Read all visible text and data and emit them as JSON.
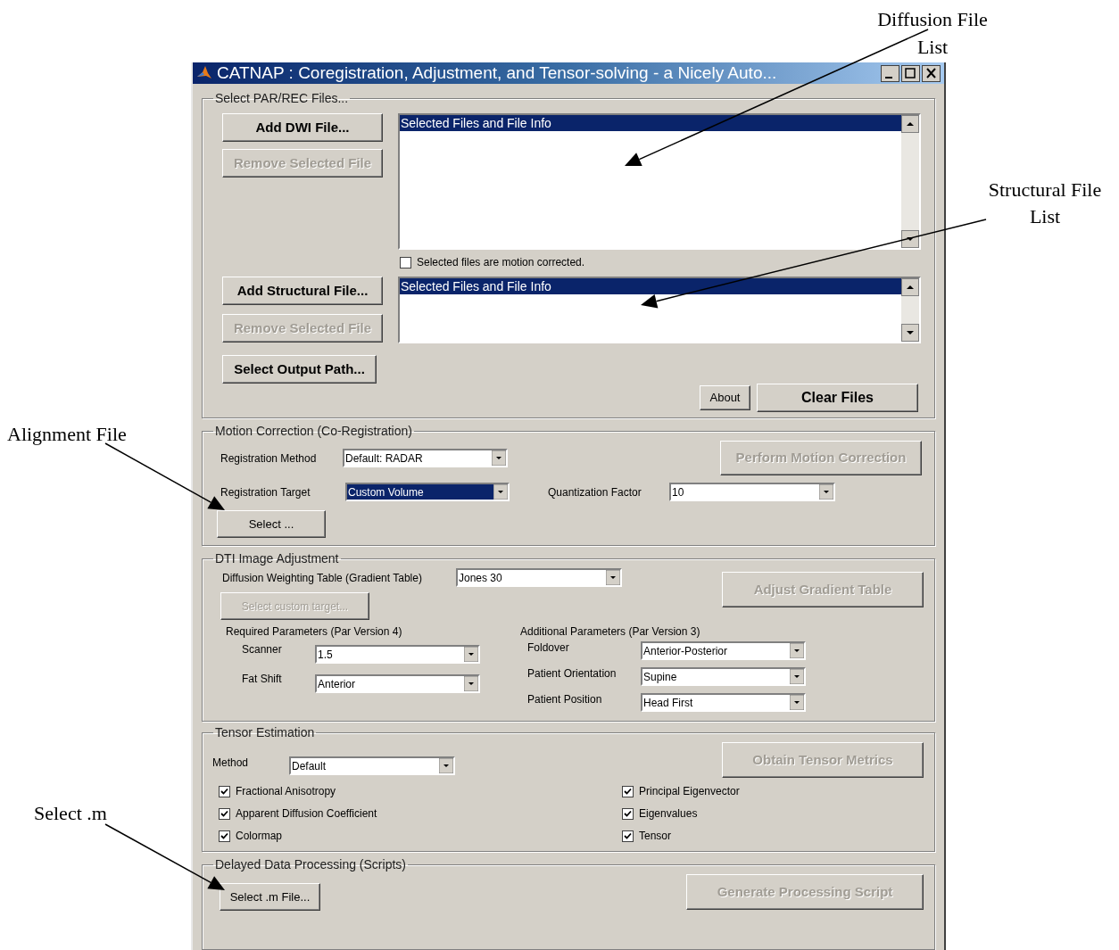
{
  "annotations": [
    {
      "text": "Diffusion File List"
    },
    {
      "text": "Structural File List"
    },
    {
      "text": "Alignment File"
    },
    {
      "text": "Select .m"
    }
  ],
  "window": {
    "title": "CATNAP : Coregistration, Adjustment, and Tensor-solving  - a Nicely Auto..."
  },
  "file_selection": {
    "title": "Select PAR/REC Files...",
    "dwi_buttons": [
      {
        "label": "Add DWI File...",
        "disabled": false
      },
      {
        "label": "Remove Selected File",
        "disabled": true
      }
    ],
    "dwi_list": {
      "header": "Selected Files and File Info"
    },
    "motion_corrected": {
      "label": "Selected files are motion corrected.",
      "checked": false
    },
    "structural_buttons": [
      {
        "label": "Add Structural File...",
        "disabled": false
      },
      {
        "label": "Remove Selected File",
        "disabled": true
      }
    ],
    "structural_list": {
      "header": "Selected Files and File Info"
    },
    "output_button": {
      "label": "Select Output Path..."
    },
    "about_button": {
      "label": "About"
    },
    "clear_button": {
      "label": "Clear Files"
    }
  },
  "motion_correction": {
    "title": "Motion Correction (Co-Registration)",
    "method": {
      "label": "Registration Method",
      "value": "Default: RADAR",
      "selected": false
    },
    "target": {
      "label": "Registration Target",
      "value": "Custom Volume",
      "selected": true
    },
    "quantization": {
      "label": "Quantization Factor",
      "value": "10",
      "selected": false
    },
    "select_button": {
      "label": "Select ..."
    },
    "perform_button": {
      "label": "Perform Motion Correction",
      "disabled": true
    }
  },
  "dti": {
    "title": "DTI Image Adjustment",
    "table": {
      "label": "Diffusion Weighting Table (Gradient Table)",
      "value": "Jones 30"
    },
    "custom_target_button": {
      "label": "Select custom target...",
      "disabled": true
    },
    "adjust_button": {
      "label": "Adjust Gradient Table",
      "disabled": true
    },
    "required": {
      "title": "Required Parameters (Par Version 4)",
      "fields": [
        {
          "label": "Scanner",
          "value": "1.5"
        },
        {
          "label": "Fat Shift",
          "value": "Anterior"
        }
      ]
    },
    "additional": {
      "title": "Additional Parameters (Par Version 3)",
      "fields": [
        {
          "label": "Foldover",
          "value": "Anterior-Posterior"
        },
        {
          "label": "Patient Orientation",
          "value": "Supine"
        },
        {
          "label": "Patient Position",
          "value": "Head First"
        }
      ]
    }
  },
  "tensor": {
    "title": "Tensor Estimation",
    "method": {
      "label": "Method",
      "value": "Default"
    },
    "obtain_button": {
      "label": "Obtain Tensor Metrics",
      "disabled": true
    },
    "checkboxes": [
      {
        "label": "Fractional Anisotropy",
        "checked": true
      },
      {
        "label": "Apparent Diffusion Coefficient",
        "checked": true
      },
      {
        "label": "Colormap",
        "checked": true
      },
      {
        "label": "Principal Eigenvector",
        "checked": true
      },
      {
        "label": "Eigenvalues",
        "checked": true
      },
      {
        "label": "Tensor",
        "checked": true
      }
    ]
  },
  "delayed": {
    "title": "Delayed Data Processing (Scripts)",
    "select_button": {
      "label": "Select .m File..."
    },
    "generate_button": {
      "label": "Generate Processing Script",
      "disabled": true
    }
  }
}
